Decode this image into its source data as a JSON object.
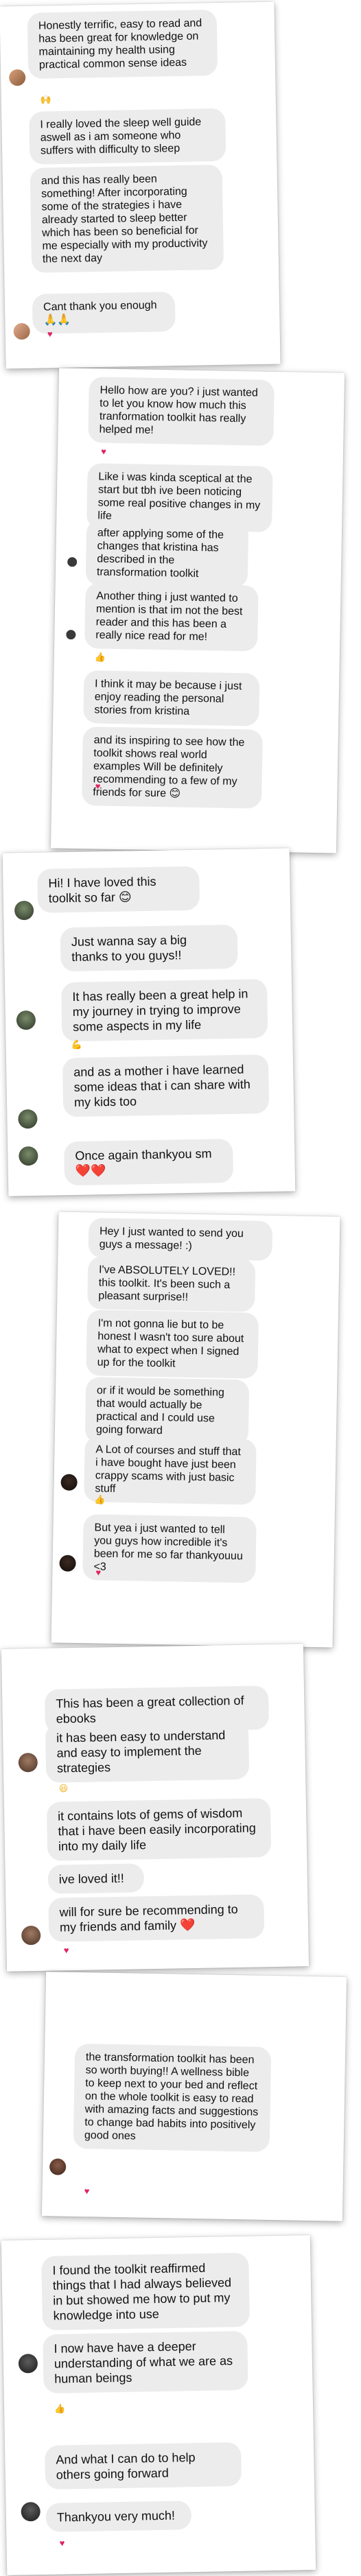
{
  "cards": [
    {
      "bubbles": [
        "Honestly terrific, easy to read and has been great for knowledge on maintaining my health using practical common sense ideas",
        "I really loved the sleep well guide aswell as i am someone who suffers with difficulty to sleep",
        "and this has really been something! After incorporating some of the strategies i have already started to sleep better which has been so beneficial for me especially with my productivity the next day",
        "Cant thank you enough 🙏🙏"
      ],
      "reactions": [
        "raised-hands",
        "heart"
      ]
    },
    {
      "bubbles": [
        "Hello how are you? i just wanted to let you know how much this tranformation toolkit has really helped me!",
        "Like i was kinda sceptical at the start but tbh ive been noticing some real positive changes in my life",
        "after applying some of the changes that kristina has described in the transformation toolkit",
        "Another thing i just wanted to mention is that im not the best reader and this has been a really nice read for me!",
        "I think it may be because i just enjoy reading the personal stories from kristina",
        "and its inspiring to see how the toolkit shows real world examples Will be definitely recommending to a few of my friends for sure 😊"
      ],
      "reactions": [
        "heart",
        "thumbs-up",
        "heart"
      ]
    },
    {
      "bubbles": [
        "Hi! I have loved this toolkit so far 😊",
        "Just wanna say a big thanks to you guys!!",
        "It has really been a great help in my journey in trying to improve some aspects in my life",
        "and as a mother i have learned some ideas that i can share with my kids too",
        "Once again thankyou sm ❤️❤️"
      ],
      "reactions": [
        "flexed-biceps",
        "heart"
      ]
    },
    {
      "bubbles": [
        "Hey I just wanted to send you guys a message! :)",
        "I've ABSOLUTELY LOVED!! this toolkit. It's been such a pleasant surprise!!",
        "I'm not gonna lie but to be honest I wasn't too sure about what to expect when I signed up for the toolkit",
        "or if it would be something that would actually be practical and I could use going forward",
        "A Lot of courses and stuff that i have bought have just been crappy scams with just basic stuff",
        "But yea i just wanted to tell you guys how incredible it's been for me so far thankyouuu <3"
      ],
      "reactions": [
        "thumbs-up",
        "heart"
      ]
    },
    {
      "bubbles": [
        "This has been a great collection of ebooks",
        "it has been easy to understand and easy to implement the strategies",
        "it contains lots of gems of wisdom that i have been easily incorporating into my daily life",
        "ive loved it!!",
        "will for sure be recommending to my friends and family ❤️"
      ],
      "reactions": [
        "grinning-face",
        "heart"
      ]
    },
    {
      "bubbles": [
        "the transformation toolkit has been so worth buying!! A wellness bible to keep next to your bed and reflect on the whole toolkit is easy to read with amazing facts and suggestions to change bad habits into positively good ones"
      ],
      "reactions": [
        "heart"
      ]
    },
    {
      "bubbles": [
        "I found the toolkit reaffirmed things that I had always believed in but showed me how to put my knowledge into use",
        "I now have have a deeper understanding of what we are as human beings",
        "And what I can do to help others going forward",
        "Thankyou very much!"
      ],
      "reactions": [
        "thumbs-up",
        "heart"
      ]
    }
  ],
  "icons": {
    "heart": "♥",
    "raised-hands": "🙌",
    "thumbs-up": "👍",
    "flexed-biceps": "💪",
    "grinning-face": "😆"
  },
  "colors": {
    "bubble_bg": "#ececec",
    "heart": "#e0245e",
    "card_bg": "#ffffff"
  }
}
